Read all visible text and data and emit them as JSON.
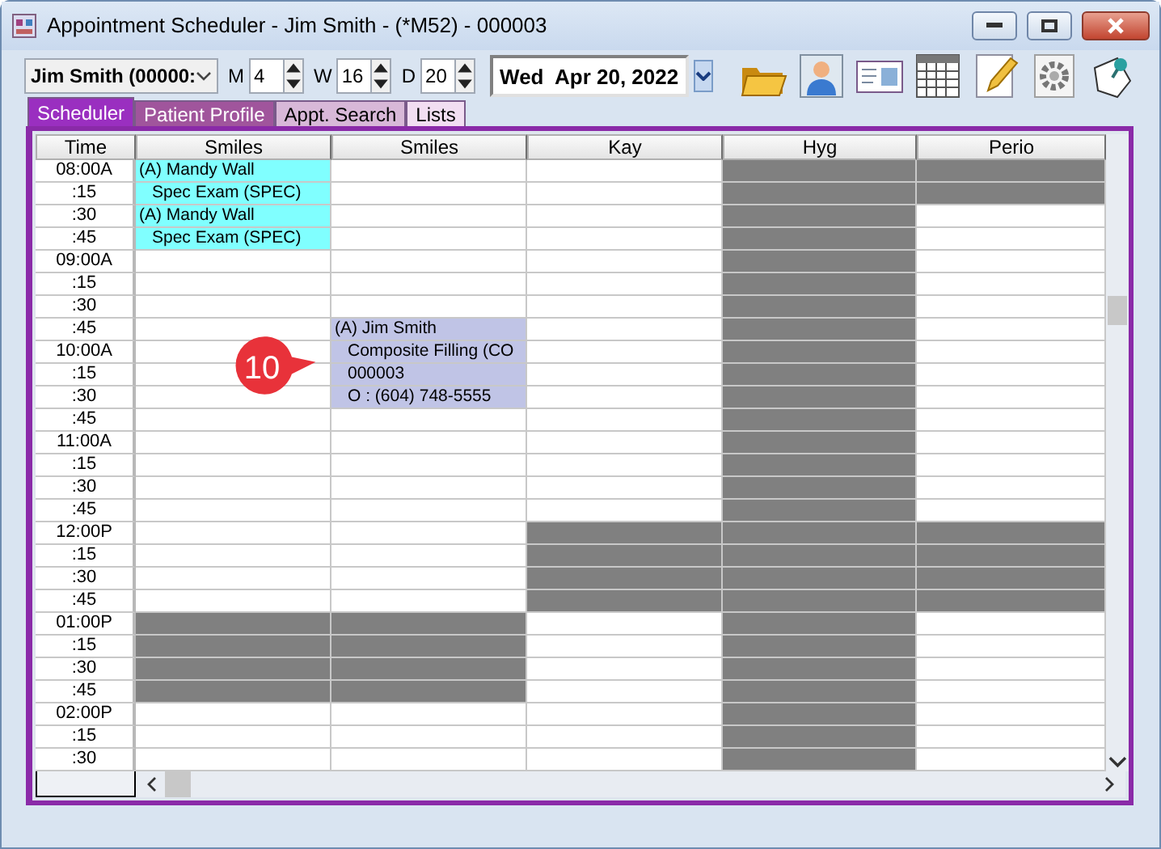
{
  "window": {
    "title": "Appointment Scheduler - Jim Smith - (*M52) - 000003"
  },
  "toolbar": {
    "patient": "Jim Smith (00000:",
    "spinners": [
      {
        "label": "M",
        "value": "4"
      },
      {
        "label": "W",
        "value": "16"
      },
      {
        "label": "D",
        "value": "20"
      }
    ],
    "date": "Wed  Apr 20, 2022"
  },
  "tabs": [
    {
      "label": "Scheduler",
      "selected": true,
      "color": "#9a2fc0"
    },
    {
      "label": "Patient Profile",
      "selected": false,
      "color": "#a0559c"
    },
    {
      "label": "Appt. Search",
      "selected": false,
      "color": "#d8b8d8"
    },
    {
      "label": "Lists",
      "selected": false,
      "color": "#f2def2"
    }
  ],
  "grid": {
    "columns": [
      "Time",
      "Smiles",
      "Smiles",
      "Kay",
      "Hyg",
      "Perio"
    ],
    "rows": [
      {
        "time": "08:00A",
        "slots": [
          {
            "kind": "appt",
            "text": "(A) Mandy Wall",
            "color": "#80ffff"
          },
          {
            "kind": "open"
          },
          {
            "kind": "open"
          },
          {
            "kind": "blocked"
          },
          {
            "kind": "blocked"
          }
        ]
      },
      {
        "time": ":15",
        "slots": [
          {
            "kind": "detail",
            "text": "Spec Exam (SPEC)",
            "color": "#80ffff"
          },
          {
            "kind": "open"
          },
          {
            "kind": "open"
          },
          {
            "kind": "blocked"
          },
          {
            "kind": "blocked"
          }
        ]
      },
      {
        "time": ":30",
        "slots": [
          {
            "kind": "appt",
            "text": "(A) Mandy Wall",
            "color": "#80ffff"
          },
          {
            "kind": "open"
          },
          {
            "kind": "open"
          },
          {
            "kind": "blocked"
          },
          {
            "kind": "open"
          }
        ]
      },
      {
        "time": ":45",
        "slots": [
          {
            "kind": "detail",
            "text": "Spec Exam (SPEC)",
            "color": "#80ffff"
          },
          {
            "kind": "open"
          },
          {
            "kind": "open"
          },
          {
            "kind": "blocked"
          },
          {
            "kind": "open"
          }
        ]
      },
      {
        "time": "09:00A",
        "slots": [
          {
            "kind": "open"
          },
          {
            "kind": "open"
          },
          {
            "kind": "open"
          },
          {
            "kind": "blocked"
          },
          {
            "kind": "open"
          }
        ]
      },
      {
        "time": ":15",
        "slots": [
          {
            "kind": "open"
          },
          {
            "kind": "open"
          },
          {
            "kind": "open"
          },
          {
            "kind": "blocked"
          },
          {
            "kind": "open"
          }
        ]
      },
      {
        "time": ":30",
        "slots": [
          {
            "kind": "open"
          },
          {
            "kind": "open"
          },
          {
            "kind": "open"
          },
          {
            "kind": "blocked"
          },
          {
            "kind": "open"
          }
        ]
      },
      {
        "time": ":45",
        "slots": [
          {
            "kind": "open"
          },
          {
            "kind": "appt",
            "text": "(A) Jim Smith",
            "color": "#c0c4e6"
          },
          {
            "kind": "open"
          },
          {
            "kind": "blocked"
          },
          {
            "kind": "open"
          }
        ]
      },
      {
        "time": "10:00A",
        "slots": [
          {
            "kind": "open"
          },
          {
            "kind": "detail",
            "text": "Composite Filling (CO",
            "color": "#c0c4e6"
          },
          {
            "kind": "open"
          },
          {
            "kind": "blocked"
          },
          {
            "kind": "open"
          }
        ]
      },
      {
        "time": ":15",
        "slots": [
          {
            "kind": "open"
          },
          {
            "kind": "detail",
            "text": "000003",
            "color": "#c0c4e6"
          },
          {
            "kind": "open"
          },
          {
            "kind": "blocked"
          },
          {
            "kind": "open"
          }
        ]
      },
      {
        "time": ":30",
        "slots": [
          {
            "kind": "open"
          },
          {
            "kind": "detail",
            "text": "O : (604) 748-5555",
            "color": "#c0c4e6"
          },
          {
            "kind": "open"
          },
          {
            "kind": "blocked"
          },
          {
            "kind": "open"
          }
        ]
      },
      {
        "time": ":45",
        "slots": [
          {
            "kind": "open"
          },
          {
            "kind": "open"
          },
          {
            "kind": "open"
          },
          {
            "kind": "blocked"
          },
          {
            "kind": "open"
          }
        ]
      },
      {
        "time": "11:00A",
        "slots": [
          {
            "kind": "open"
          },
          {
            "kind": "open"
          },
          {
            "kind": "open"
          },
          {
            "kind": "blocked"
          },
          {
            "kind": "open"
          }
        ]
      },
      {
        "time": ":15",
        "slots": [
          {
            "kind": "open"
          },
          {
            "kind": "open"
          },
          {
            "kind": "open"
          },
          {
            "kind": "blocked"
          },
          {
            "kind": "open"
          }
        ]
      },
      {
        "time": ":30",
        "slots": [
          {
            "kind": "open"
          },
          {
            "kind": "open"
          },
          {
            "kind": "open"
          },
          {
            "kind": "blocked"
          },
          {
            "kind": "open"
          }
        ]
      },
      {
        "time": ":45",
        "slots": [
          {
            "kind": "open"
          },
          {
            "kind": "open"
          },
          {
            "kind": "open"
          },
          {
            "kind": "blocked"
          },
          {
            "kind": "open"
          }
        ]
      },
      {
        "time": "12:00P",
        "slots": [
          {
            "kind": "open"
          },
          {
            "kind": "open"
          },
          {
            "kind": "blocked"
          },
          {
            "kind": "blocked"
          },
          {
            "kind": "blocked"
          }
        ]
      },
      {
        "time": ":15",
        "slots": [
          {
            "kind": "open"
          },
          {
            "kind": "open"
          },
          {
            "kind": "blocked"
          },
          {
            "kind": "blocked"
          },
          {
            "kind": "blocked"
          }
        ]
      },
      {
        "time": ":30",
        "slots": [
          {
            "kind": "open"
          },
          {
            "kind": "open"
          },
          {
            "kind": "blocked"
          },
          {
            "kind": "blocked"
          },
          {
            "kind": "blocked"
          }
        ]
      },
      {
        "time": ":45",
        "slots": [
          {
            "kind": "open"
          },
          {
            "kind": "open"
          },
          {
            "kind": "blocked"
          },
          {
            "kind": "blocked"
          },
          {
            "kind": "blocked"
          }
        ]
      },
      {
        "time": "01:00P",
        "slots": [
          {
            "kind": "blocked"
          },
          {
            "kind": "blocked"
          },
          {
            "kind": "open"
          },
          {
            "kind": "blocked"
          },
          {
            "kind": "open"
          }
        ]
      },
      {
        "time": ":15",
        "slots": [
          {
            "kind": "blocked"
          },
          {
            "kind": "blocked"
          },
          {
            "kind": "open"
          },
          {
            "kind": "blocked"
          },
          {
            "kind": "open"
          }
        ]
      },
      {
        "time": ":30",
        "slots": [
          {
            "kind": "blocked"
          },
          {
            "kind": "blocked"
          },
          {
            "kind": "open"
          },
          {
            "kind": "blocked"
          },
          {
            "kind": "open"
          }
        ]
      },
      {
        "time": ":45",
        "slots": [
          {
            "kind": "blocked"
          },
          {
            "kind": "blocked"
          },
          {
            "kind": "open"
          },
          {
            "kind": "blocked"
          },
          {
            "kind": "open"
          }
        ]
      },
      {
        "time": "02:00P",
        "slots": [
          {
            "kind": "open"
          },
          {
            "kind": "open"
          },
          {
            "kind": "open"
          },
          {
            "kind": "blocked"
          },
          {
            "kind": "open"
          }
        ]
      },
      {
        "time": ":15",
        "slots": [
          {
            "kind": "open"
          },
          {
            "kind": "open"
          },
          {
            "kind": "open"
          },
          {
            "kind": "blocked"
          },
          {
            "kind": "open"
          }
        ]
      },
      {
        "time": ":30",
        "slots": [
          {
            "kind": "open"
          },
          {
            "kind": "open"
          },
          {
            "kind": "open"
          },
          {
            "kind": "blocked"
          },
          {
            "kind": "open"
          }
        ]
      }
    ]
  },
  "callout": {
    "text": "10"
  }
}
